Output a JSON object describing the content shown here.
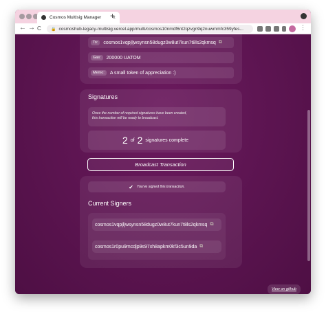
{
  "browser": {
    "tab_title": "Cosmos Multisig Manager",
    "tab_close": "×",
    "new_tab": "+",
    "url": "cosmoshub-legacy-multisig.vercel.app/multi/cosmos10nmdf6nt2qzvgn9q2nuwmmfc359yfes...",
    "back": "←",
    "forward": "→",
    "reload": "C",
    "menu": "⋮"
  },
  "tx": {
    "to_label": "To:",
    "to_value": "cosmos1vqpjljwsynsn58dugz0w8ut7kun7t8ls2qkmsq",
    "gas_label": "Gas:",
    "gas_value": "200000 UATOM",
    "memo_label": "Memo:",
    "memo_value": "A small token of appreciation :)"
  },
  "signatures": {
    "title": "Signatures",
    "note_line1": "Once the number of required signatures have been created,",
    "note_line2": "this transaction will be ready to broadcast.",
    "current": "2",
    "of": "of",
    "required": "2",
    "complete_label": "signatures complete"
  },
  "broadcast_label": "Broadcast Transaction",
  "signed_status": "You've signed this transaction.",
  "signers": {
    "title": "Current Signers",
    "list": [
      "cosmos1vqpjljwsynsn58dugz0w8ut7kun7t8ls2qkmsq",
      "cosmos1r0pu9mcdjp9s97xh8apkm0kf3c5un9da"
    ]
  },
  "github_label": "View on github",
  "colors": {
    "background": "#5c1250",
    "accent": "#ffffff"
  }
}
